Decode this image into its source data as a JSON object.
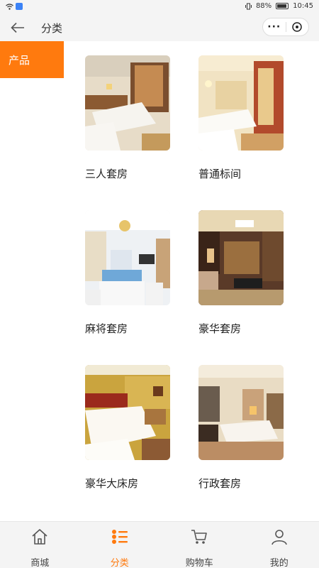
{
  "status_bar": {
    "battery": "88%",
    "time": "10:45"
  },
  "header": {
    "title": "分类"
  },
  "sidebar": {
    "items": [
      {
        "label": "产品"
      }
    ]
  },
  "products": [
    {
      "name": "三人套房"
    },
    {
      "name": "普通标间"
    },
    {
      "name": "麻将套房"
    },
    {
      "name": "豪华套房"
    },
    {
      "name": "豪华大床房"
    },
    {
      "name": "行政套房"
    }
  ],
  "tabbar": {
    "tabs": [
      {
        "label": "商城",
        "icon": "home-icon"
      },
      {
        "label": "分类",
        "icon": "category-icon"
      },
      {
        "label": "购物车",
        "icon": "cart-icon"
      },
      {
        "label": "我的",
        "icon": "user-icon"
      }
    ]
  },
  "colors": {
    "accent": "#ff7a0e",
    "bar_bg": "#f4f4f4"
  }
}
